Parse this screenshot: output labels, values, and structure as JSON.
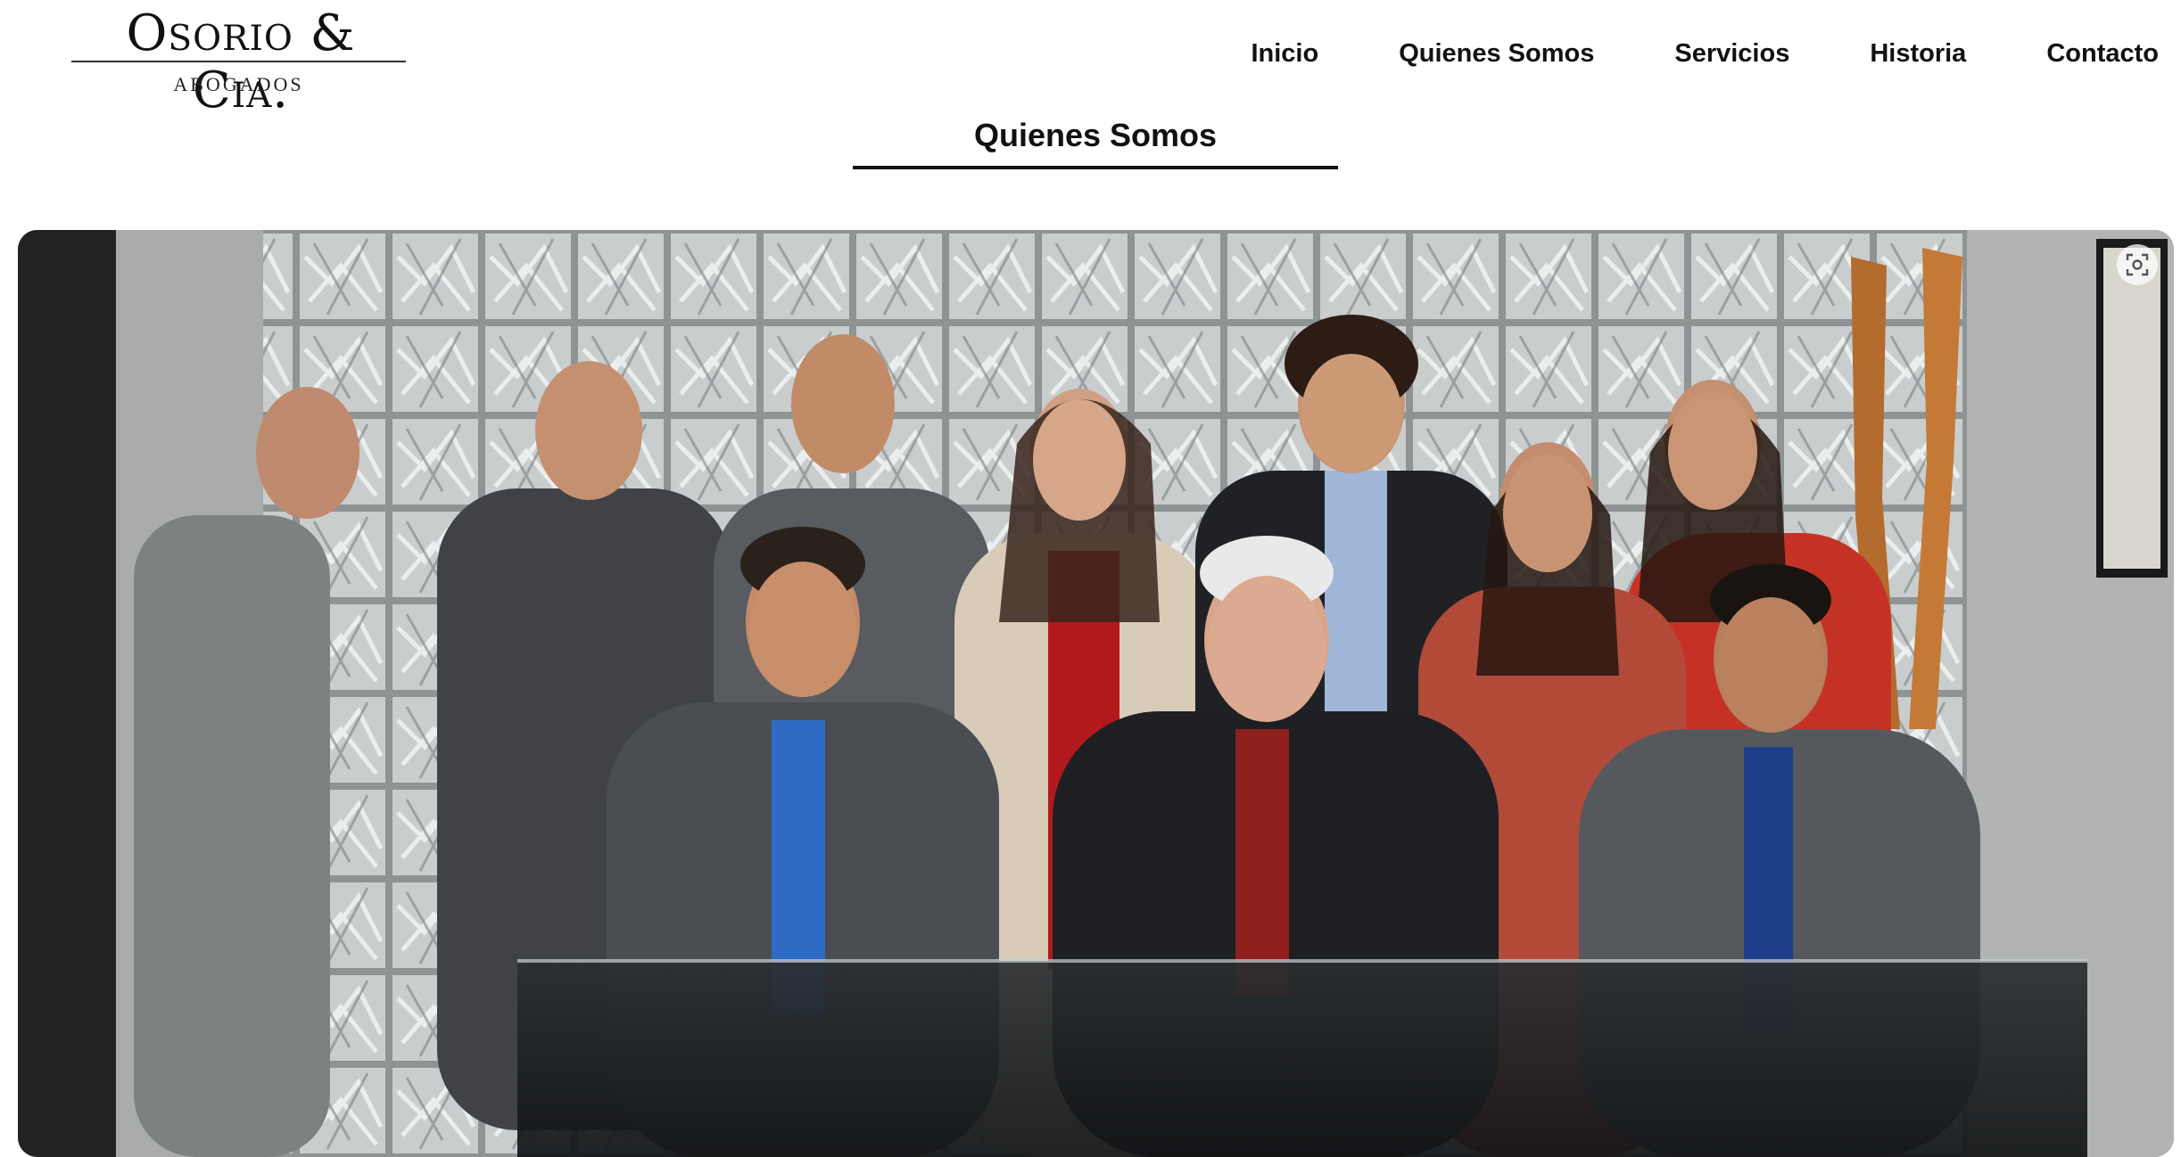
{
  "brand": {
    "name": "Osorio & Cia.",
    "subtitle": "ABOGADOS"
  },
  "nav": {
    "items": [
      {
        "label": "Inicio"
      },
      {
        "label": "Quienes Somos"
      },
      {
        "label": "Servicios"
      },
      {
        "label": "Historia"
      },
      {
        "label": "Contacto"
      }
    ]
  },
  "section": {
    "title": "Quienes Somos"
  },
  "hero": {
    "icon": "visual-search-icon"
  },
  "colors": {
    "text": "#111111",
    "background": "#ffffff"
  }
}
